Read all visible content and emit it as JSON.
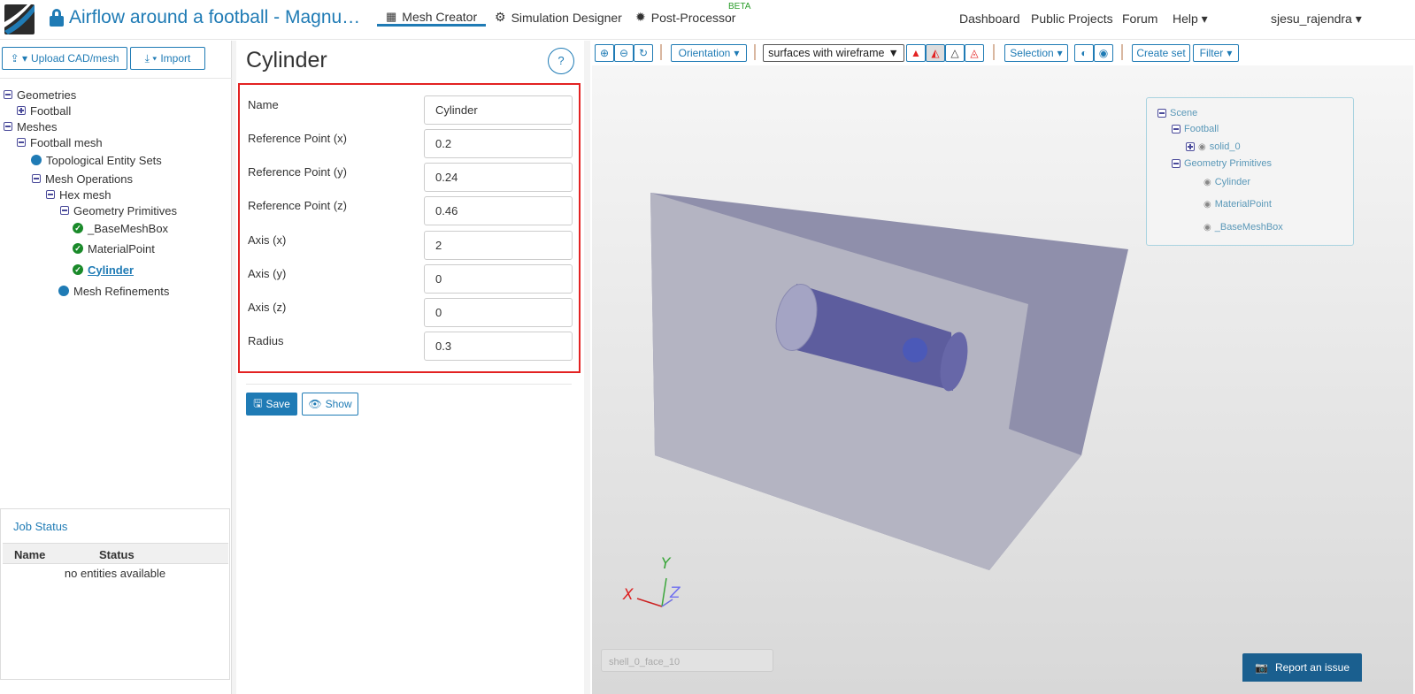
{
  "header": {
    "project_title": "Airflow around a football - Magnu…",
    "tabs": [
      {
        "label": "Mesh Creator",
        "icon": "grid-icon",
        "active": true
      },
      {
        "label": "Simulation Designer",
        "icon": "gears-icon"
      },
      {
        "label": "Post-Processor",
        "icon": "cog-icon",
        "badge": "BETA"
      }
    ],
    "right_nav": [
      "Dashboard",
      "Public Projects",
      "Forum",
      "Help",
      "sjesu_rajendra"
    ]
  },
  "left": {
    "upload_label": "Upload CAD/mesh",
    "import_label": "Import",
    "tree": [
      {
        "label": "Geometries",
        "level": 0,
        "icon": "collapse"
      },
      {
        "label": "Football",
        "level": 1,
        "icon": "expand"
      },
      {
        "label": "Meshes",
        "level": 0,
        "icon": "collapse"
      },
      {
        "label": "Football mesh",
        "level": 1,
        "icon": "collapse"
      },
      {
        "label": "Topological Entity Sets",
        "level": 2,
        "icon": "dot"
      },
      {
        "label": "Mesh Operations",
        "level": 2,
        "icon": "collapse"
      },
      {
        "label": "Hex mesh",
        "level": 3,
        "icon": "collapse"
      },
      {
        "label": "Geometry Primitives",
        "level": 4,
        "icon": "collapse"
      },
      {
        "label": "_BaseMeshBox",
        "level": 5,
        "icon": "check"
      },
      {
        "label": "MaterialPoint",
        "level": 5,
        "icon": "check"
      },
      {
        "label": "Cylinder",
        "level": 5,
        "icon": "check",
        "selected": true
      },
      {
        "label": "Mesh Refinements",
        "level": 4,
        "icon": "dot"
      }
    ],
    "job_status": {
      "title": "Job Status",
      "columns": [
        "Name",
        "Status"
      ],
      "empty": "no entities available"
    }
  },
  "form": {
    "title": "Cylinder",
    "help": "?",
    "fields": [
      {
        "label": "Name",
        "value": "Cylinder"
      },
      {
        "label": "Reference Point (x)",
        "value": "0.2"
      },
      {
        "label": "Reference Point (y)",
        "value": "0.24"
      },
      {
        "label": "Reference Point (z)",
        "value": "0.46"
      },
      {
        "label": "Axis (x)",
        "value": "2"
      },
      {
        "label": "Axis (y)",
        "value": "0"
      },
      {
        "label": "Axis (z)",
        "value": "0"
      },
      {
        "label": "Radius",
        "value": "0.3"
      }
    ],
    "save": "Save",
    "show": "Show"
  },
  "viewer": {
    "orientation": "Orientation",
    "render_mode": "surfaces with wireframe",
    "selection": "Selection",
    "create_set": "Create set",
    "filter": "Filter",
    "scene_tree": [
      {
        "label": "Scene",
        "level": 0
      },
      {
        "label": "Football",
        "level": 1
      },
      {
        "label": "solid_0",
        "level": 2
      },
      {
        "label": "Geometry Primitives",
        "level": 1
      },
      {
        "label": "Cylinder",
        "level": 3
      },
      {
        "label": "MaterialPoint",
        "level": 3
      },
      {
        "label": "_BaseMeshBox",
        "level": 3
      }
    ],
    "axes": {
      "x": "X",
      "y": "Y",
      "z": "Z"
    },
    "hover_info": "shell_0_face_10",
    "report": "Report an issue"
  },
  "colors": {
    "accent": "#1f7bb5",
    "highlight": "#e32222",
    "success": "#1a8a2a"
  }
}
